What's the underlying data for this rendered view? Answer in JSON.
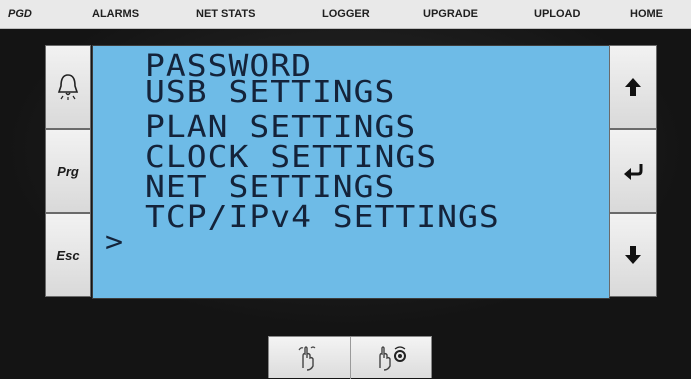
{
  "topbar": {
    "brand": "PGD",
    "items": [
      "ALARMS",
      "NET STATS",
      "LOGGER",
      "UPGRADE",
      "UPLOAD",
      "HOME"
    ]
  },
  "lcd": {
    "cursor": ">",
    "lines": [
      "PASSWORD",
      "USB SETTINGS",
      "PLAN SETTINGS",
      "CLOCK SETTINGS",
      "NET SETTINGS",
      "TCP/IPv4 SETTINGS"
    ],
    "selected_index": 5
  },
  "left_buttons": {
    "alarm_icon": "bell-icon",
    "prg_label": "Prg",
    "esc_label": "Esc"
  },
  "right_buttons": {
    "up_icon": "arrow-up-icon",
    "enter_icon": "enter-return-icon",
    "down_icon": "arrow-down-icon"
  },
  "bottom_bar": {
    "gesture_1": "two-finger-swipe-icon",
    "gesture_2": "two-finger-tap-rotate-icon"
  },
  "colors": {
    "lcd_background": "#6ebbe7",
    "lcd_text": "#14233a",
    "topbar": "#e9e9e9"
  }
}
